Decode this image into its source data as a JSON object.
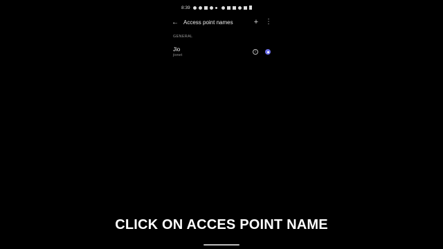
{
  "status_bar": {
    "time": "8:39",
    "icons_left": [
      "whatsapp-icon",
      "snapchat-icon",
      "gallery-icon",
      "chrome-icon",
      "notification-dot-icon"
    ],
    "icons_right": [
      "alarm-icon",
      "mute-icon",
      "vibrate-icon",
      "wifi-icon",
      "volte-icon",
      "battery-icon"
    ]
  },
  "app_bar": {
    "title": "Access point names",
    "back_icon": "back-arrow-icon",
    "add_label": "+",
    "more_label": "⋮"
  },
  "section_header": "GENERAL",
  "apn_list": [
    {
      "name": "Jio",
      "apn": "jionet",
      "selected": true,
      "accent": "#6c6fe8"
    }
  ],
  "caption": "CLICK ON ACCES POINT NAME"
}
